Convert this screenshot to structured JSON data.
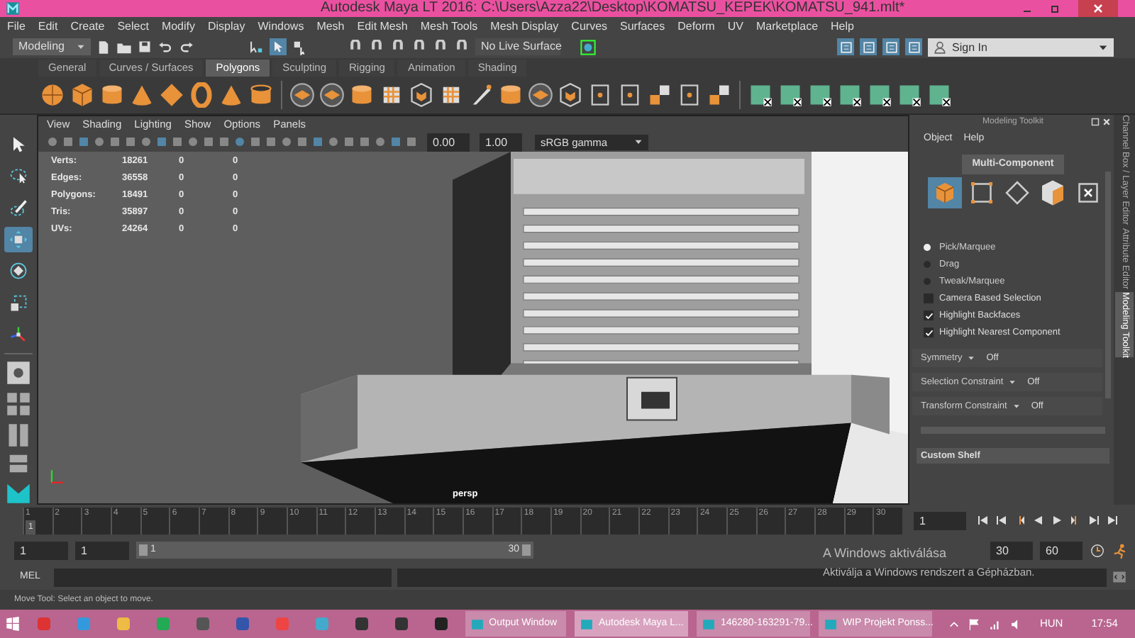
{
  "window": {
    "title": "Autodesk Maya LT 2016: C:\\Users\\Azza22\\Desktop\\KOMATSU_KEPEK\\KOMATSU_941.mlt*"
  },
  "menu": [
    "File",
    "Edit",
    "Create",
    "Select",
    "Modify",
    "Display",
    "Windows",
    "Mesh",
    "Edit Mesh",
    "Mesh Tools",
    "Mesh Display",
    "Curves",
    "Surfaces",
    "Deform",
    "UV",
    "Marketplace",
    "Help"
  ],
  "status_line": {
    "mode": "Modeling",
    "live_surface": "No Live Surface",
    "sign_in": "Sign In"
  },
  "shelf_tabs": [
    {
      "label": "General",
      "selected": false
    },
    {
      "label": "Curves / Surfaces",
      "selected": false
    },
    {
      "label": "Polygons",
      "selected": true
    },
    {
      "label": "Sculpting",
      "selected": false
    },
    {
      "label": "Rigging",
      "selected": false
    },
    {
      "label": "Animation",
      "selected": false
    },
    {
      "label": "Shading",
      "selected": false
    }
  ],
  "toolbox": [
    {
      "kind": "select",
      "selected": false
    },
    {
      "kind": "lasso",
      "selected": false
    },
    {
      "kind": "paint",
      "selected": false
    },
    {
      "kind": "move",
      "selected": true
    },
    {
      "kind": "rotate",
      "selected": false
    },
    {
      "kind": "scale",
      "selected": false
    },
    {
      "kind": "manipulator",
      "selected": false
    }
  ],
  "viewport": {
    "menu": [
      "View",
      "Shading",
      "Lighting",
      "Show",
      "Options",
      "Panels"
    ],
    "exposure": "0.00",
    "gamma": "1.00",
    "color_space": "sRGB gamma",
    "stats": [
      {
        "label": "Verts:",
        "values": [
          "18261",
          "0",
          "0"
        ]
      },
      {
        "label": "Edges:",
        "values": [
          "36558",
          "0",
          "0"
        ]
      },
      {
        "label": "Polygons:",
        "values": [
          "18491",
          "0",
          "0"
        ]
      },
      {
        "label": "Tris:",
        "values": [
          "35897",
          "0",
          "0"
        ]
      },
      {
        "label": "UVs:",
        "values": [
          "24264",
          "0",
          "0"
        ]
      }
    ],
    "camera": "persp"
  },
  "modeling_toolkit": {
    "title": "Modeling Toolkit",
    "menu": [
      "Object",
      "Help"
    ],
    "mode_button": "Multi-Component",
    "options": [
      {
        "kind": "radio",
        "label": "Pick/Marquee",
        "selected": true
      },
      {
        "kind": "radio",
        "label": "Drag",
        "selected": false
      },
      {
        "kind": "radio",
        "label": "Tweak/Marquee",
        "selected": false
      },
      {
        "kind": "checkbox",
        "label": "Camera Based Selection",
        "checked": false
      },
      {
        "kind": "checkbox",
        "label": "Highlight Backfaces",
        "checked": true
      },
      {
        "kind": "checkbox",
        "label": "Highlight Nearest Component",
        "checked": true
      }
    ],
    "rows": [
      {
        "label": "Symmetry",
        "value": "Off"
      },
      {
        "label": "Selection Constraint",
        "value": "Off"
      },
      {
        "label": "Transform Constraint",
        "value": "Off"
      }
    ],
    "custom_shelf": "Custom Shelf"
  },
  "side_tabs": [
    {
      "label": "Channel Box / Layer Editor",
      "selected": false
    },
    {
      "label": "Attribute Editor",
      "selected": false
    },
    {
      "label": "Modeling Toolkit",
      "selected": true
    }
  ],
  "time_slider": {
    "ticks": [
      "1",
      "2",
      "3",
      "4",
      "5",
      "6",
      "7",
      "8",
      "9",
      "10",
      "11",
      "12",
      "13",
      "14",
      "15",
      "16",
      "17",
      "18",
      "19",
      "20",
      "21",
      "22",
      "23",
      "24",
      "25",
      "26",
      "27",
      "28",
      "29",
      "30"
    ],
    "current": "1",
    "level": 0,
    "frame_field": "1"
  },
  "range": {
    "start": "1",
    "playback_start": "1",
    "range_start": "1",
    "range_end": "30",
    "playback_end": "30",
    "end": "60",
    "level": 1
  },
  "command": {
    "label": "MEL"
  },
  "help_line": "Move Tool: Select an object to move.",
  "activation": {
    "title": "A Windows aktiválása",
    "message": "Aktiválja a Windows rendszert a Gépházban."
  },
  "taskbar": {
    "windows": [
      {
        "label": "Output Window",
        "selected": false
      },
      {
        "label": "Autodesk Maya L...",
        "selected": true
      },
      {
        "label": "146280-163291-79...",
        "selected": false
      },
      {
        "label": "WIP Projekt Ponss...",
        "selected": false
      }
    ],
    "language": "HUN",
    "time": "17:54"
  }
}
